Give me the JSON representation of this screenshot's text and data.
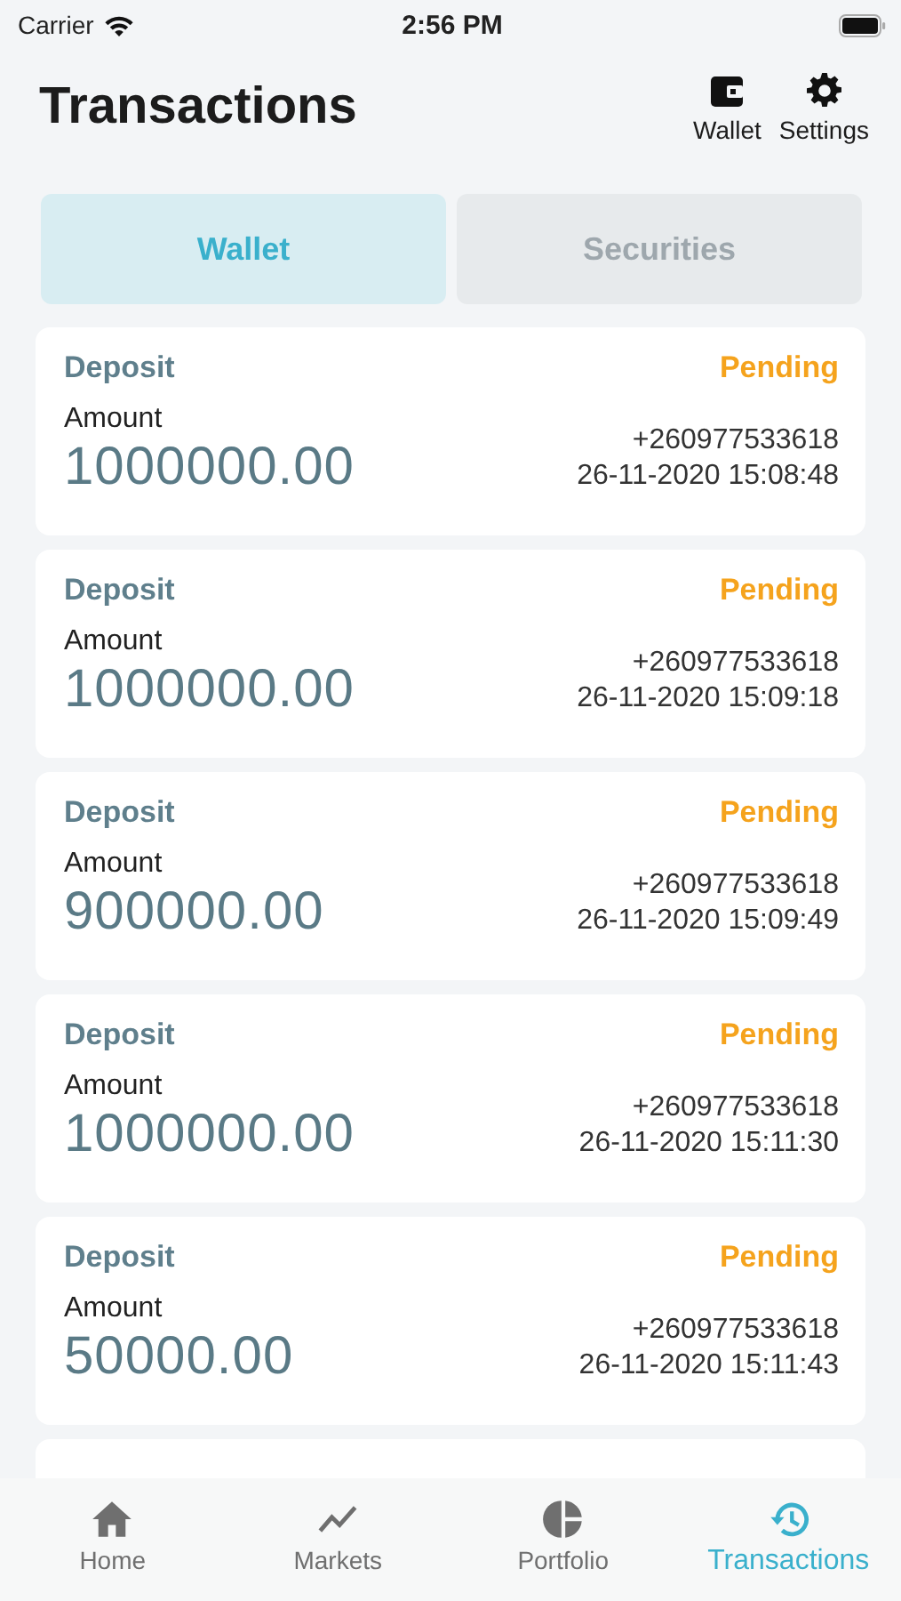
{
  "status_bar": {
    "carrier": "Carrier",
    "time": "2:56 PM"
  },
  "header": {
    "title": "Transactions",
    "actions": [
      {
        "label": "Wallet",
        "kind": "wallet"
      },
      {
        "label": "Settings",
        "kind": "settings"
      }
    ]
  },
  "tabs": [
    {
      "label": "Wallet",
      "selected": true
    },
    {
      "label": "Securities",
      "selected": false
    }
  ],
  "transactions": [
    {
      "kind": "full",
      "type": "Deposit",
      "status": "Pending",
      "amount_label": "Amount",
      "amount": "1000000.00",
      "phone": "+260977533618",
      "datetime": "26-11-2020 15:08:48"
    },
    {
      "kind": "full",
      "type": "Deposit",
      "status": "Pending",
      "amount_label": "Amount",
      "amount": "1000000.00",
      "phone": "+260977533618",
      "datetime": "26-11-2020 15:09:18"
    },
    {
      "kind": "full",
      "type": "Deposit",
      "status": "Pending",
      "amount_label": "Amount",
      "amount": "900000.00",
      "phone": "+260977533618",
      "datetime": "26-11-2020 15:09:49"
    },
    {
      "kind": "full",
      "type": "Deposit",
      "status": "Pending",
      "amount_label": "Amount",
      "amount": "1000000.00",
      "phone": "+260977533618",
      "datetime": "26-11-2020 15:11:30"
    },
    {
      "kind": "full",
      "type": "Deposit",
      "status": "Pending",
      "amount_label": "Amount",
      "amount": "50000.00",
      "phone": "+260977533618",
      "datetime": "26-11-2020 15:11:43"
    },
    {
      "kind": "clipped"
    }
  ],
  "tab_bar": [
    {
      "label": "Home",
      "kind": "home",
      "selected": false
    },
    {
      "label": "Markets",
      "kind": "chart",
      "selected": false
    },
    {
      "label": "Portfolio",
      "kind": "pie",
      "selected": false
    },
    {
      "label": "Transactions",
      "kind": "history",
      "selected": true
    }
  ]
}
